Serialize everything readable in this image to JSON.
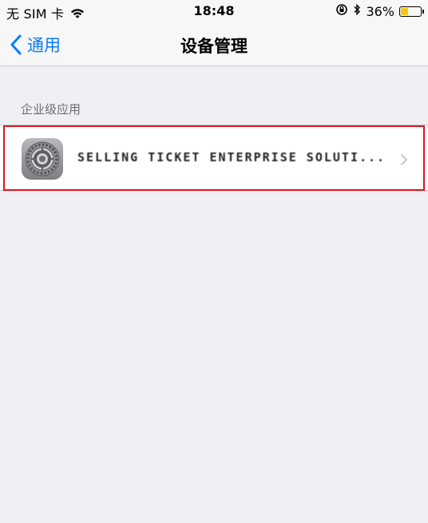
{
  "status_bar": {
    "carrier": "无 SIM 卡",
    "time": "18:48",
    "battery_percent": "36%",
    "battery_level": 0.36,
    "battery_color": "#f5c518"
  },
  "nav": {
    "back_label": "通用",
    "title": "设备管理",
    "accent_color": "#0a7aff"
  },
  "section": {
    "header": "企业级应用",
    "items": [
      {
        "name": "SELLING TICKET ENTERPRISE SOLUTI...",
        "icon": "settings-gear-icon"
      }
    ]
  }
}
